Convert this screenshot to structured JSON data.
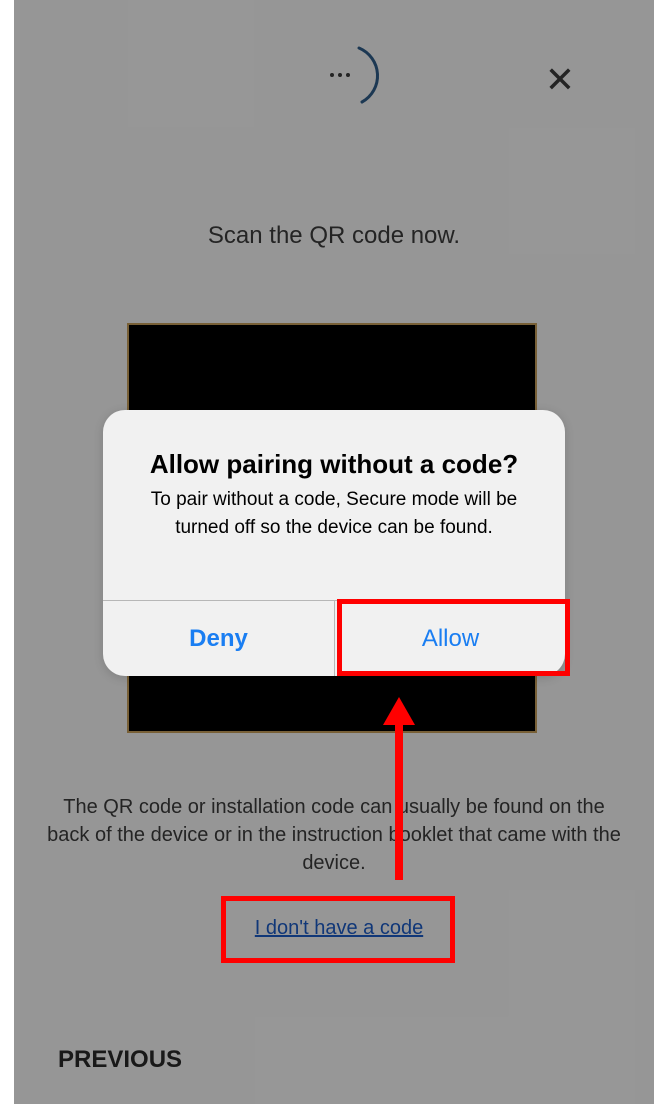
{
  "scan_title": "Scan the QR code now.",
  "close_icon": "close-icon",
  "hint": "The QR code or installation code can usually be found on the back of the device or in the instruction booklet that came with the device.",
  "no_code_link": "I don't have a code",
  "previous_label": "PREVIOUS",
  "dialog": {
    "title": "Allow pairing without a code?",
    "message": "To pair without a code, Secure mode will be turned off so the device can be found.",
    "deny_label": "Deny",
    "allow_label": "Allow"
  },
  "colors": {
    "accent": "#1a7ef2",
    "link": "#1c5cc8",
    "annotation": "#ff0000",
    "preview_border": "#c9a15c"
  }
}
